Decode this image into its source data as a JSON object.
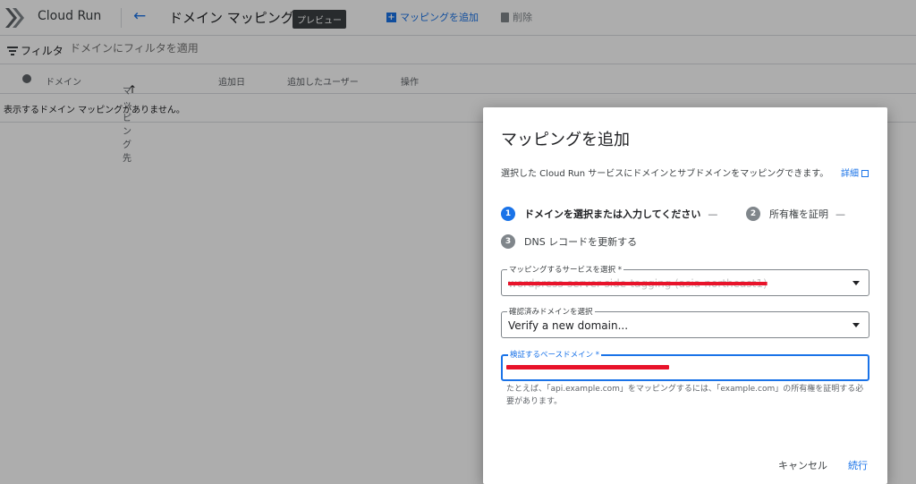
{
  "header": {
    "product_name": "Cloud Run",
    "page_title": "ドメイン マッピング",
    "badge": "プレビュー",
    "add_mapping_label": "マッピングを追加",
    "delete_label": "削除"
  },
  "filter": {
    "label": "フィルタ",
    "placeholder": "ドメインにフィルタを適用"
  },
  "table": {
    "columns": [
      "ドメイン",
      "マッピング先",
      "追加日",
      "追加したユーザー",
      "操作"
    ],
    "sorted_column": "マッピング先",
    "empty_message": "表示するドメイン マッピングがありません。"
  },
  "dialog": {
    "title": "マッピングを追加",
    "description": "選択した Cloud Run サービスにドメインとサブドメインをマッピングできます。",
    "learn_more": "詳細",
    "steps": [
      {
        "number": "1",
        "label": "ドメインを選択または入力してください",
        "active": true
      },
      {
        "number": "2",
        "label": "所有権を証明",
        "active": false
      },
      {
        "number": "3",
        "label": "DNS レコードを更新する",
        "active": false
      }
    ],
    "service_select": {
      "label": "マッピングするサービスを選択 *",
      "value": "wordpress-server-side-tagging (asia-northeast1)"
    },
    "domain_select": {
      "label": "確認済みドメインを選択",
      "value": "Verify a new domain..."
    },
    "base_domain_input": {
      "label": "検証するベースドメイン *"
    },
    "hint": "たとえば、「api.example.com」をマッピングするには、「example.com」の所有権を証明する必要があります。",
    "cancel_label": "キャンセル",
    "continue_label": "続行"
  },
  "colors": {
    "accent": "#1a73e8",
    "redaction": "#e8132a",
    "scrim": "rgba(0,0,0,0.32)"
  }
}
